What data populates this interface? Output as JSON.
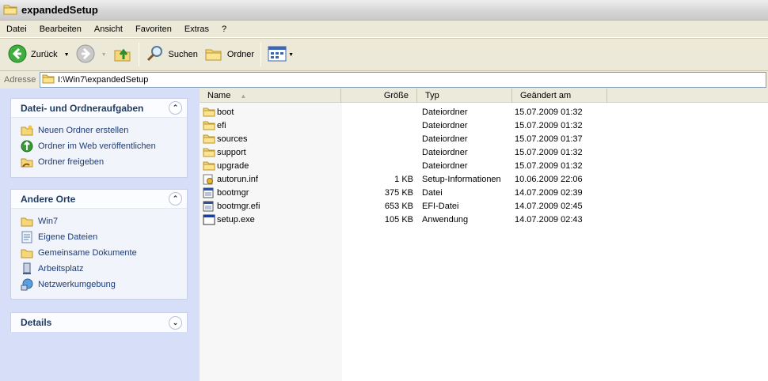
{
  "window": {
    "title": "expandedSetup"
  },
  "menu": [
    "Datei",
    "Bearbeiten",
    "Ansicht",
    "Favoriten",
    "Extras",
    "?"
  ],
  "toolbar": {
    "back_label": "Zurück",
    "search_label": "Suchen",
    "folders_label": "Ordner"
  },
  "address": {
    "label": "Adresse",
    "value": "I:\\Win7\\expandedSetup"
  },
  "tasks": {
    "file_tasks": {
      "title": "Datei- und Ordneraufgaben",
      "items": [
        {
          "label": "Neuen Ordner erstellen",
          "icon": "new-folder-icon"
        },
        {
          "label": "Ordner im Web veröffentlichen",
          "icon": "web-publish-icon"
        },
        {
          "label": "Ordner freigeben",
          "icon": "share-folder-icon"
        }
      ]
    },
    "other_places": {
      "title": "Andere Orte",
      "items": [
        {
          "label": "Win7",
          "icon": "folder-icon"
        },
        {
          "label": "Eigene Dateien",
          "icon": "my-documents-icon"
        },
        {
          "label": "Gemeinsame Dokumente",
          "icon": "shared-documents-icon"
        },
        {
          "label": "Arbeitsplatz",
          "icon": "my-computer-icon"
        },
        {
          "label": "Netzwerkumgebung",
          "icon": "network-icon"
        }
      ]
    },
    "details": {
      "title": "Details"
    }
  },
  "columns": {
    "name": "Name",
    "size": "Größe",
    "type": "Typ",
    "date": "Geändert am"
  },
  "files": [
    {
      "name": "boot",
      "size": "",
      "type": "Dateiordner",
      "date": "15.07.2009 01:32",
      "icon": "folder"
    },
    {
      "name": "efi",
      "size": "",
      "type": "Dateiordner",
      "date": "15.07.2009 01:32",
      "icon": "folder"
    },
    {
      "name": "sources",
      "size": "",
      "type": "Dateiordner",
      "date": "15.07.2009 01:37",
      "icon": "folder"
    },
    {
      "name": "support",
      "size": "",
      "type": "Dateiordner",
      "date": "15.07.2009 01:32",
      "icon": "folder"
    },
    {
      "name": "upgrade",
      "size": "",
      "type": "Dateiordner",
      "date": "15.07.2009 01:32",
      "icon": "folder"
    },
    {
      "name": "autorun.inf",
      "size": "1 KB",
      "type": "Setup-Informationen",
      "date": "10.06.2009 22:06",
      "icon": "inf"
    },
    {
      "name": "bootmgr",
      "size": "375 KB",
      "type": "Datei",
      "date": "14.07.2009 02:39",
      "icon": "file"
    },
    {
      "name": "bootmgr.efi",
      "size": "653 KB",
      "type": "EFI-Datei",
      "date": "14.07.2009 02:45",
      "icon": "file"
    },
    {
      "name": "setup.exe",
      "size": "105 KB",
      "type": "Anwendung",
      "date": "14.07.2009 02:43",
      "icon": "exe"
    }
  ],
  "colors": {
    "taskpane_bg": "#d6dff7",
    "panel_title": "#1f3a5f",
    "link": "#1c3c79"
  }
}
